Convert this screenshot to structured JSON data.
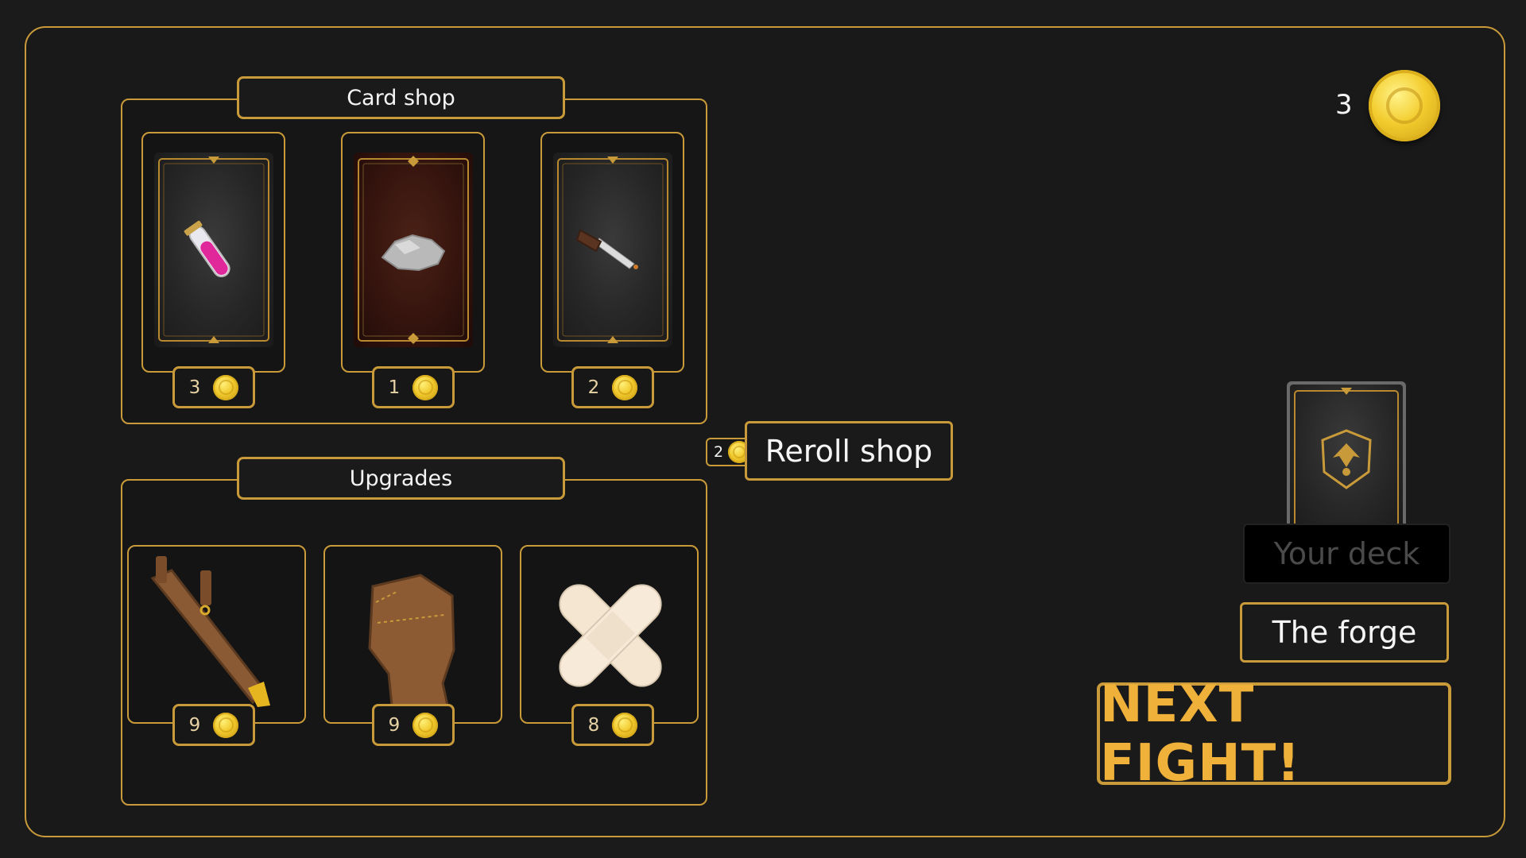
{
  "card_shop": {
    "title": "Card shop",
    "cards": [
      {
        "item": "potion-vial-icon",
        "style": "dark",
        "price": "3"
      },
      {
        "item": "rock-icon",
        "style": "red",
        "price": "1"
      },
      {
        "item": "knife-icon",
        "style": "dark",
        "price": "2"
      }
    ]
  },
  "reroll": {
    "cost": "2",
    "label": "Reroll shop"
  },
  "upgrades": {
    "title": "Upgrades",
    "items": [
      {
        "item": "leather-sheath-icon",
        "price": "9"
      },
      {
        "item": "leather-gauntlet-icon",
        "price": "9"
      },
      {
        "item": "bandage-icon",
        "price": "8"
      }
    ]
  },
  "gold": {
    "amount": "3"
  },
  "deck": {
    "label": "Your deck"
  },
  "forge": {
    "label": "The forge"
  },
  "next_fight": {
    "label": "NEXT FIGHT!"
  },
  "colors": {
    "accent": "#c99a3a",
    "background": "#1b1b1b",
    "next_text": "#f0b13a",
    "coin": "#f0c92c"
  }
}
